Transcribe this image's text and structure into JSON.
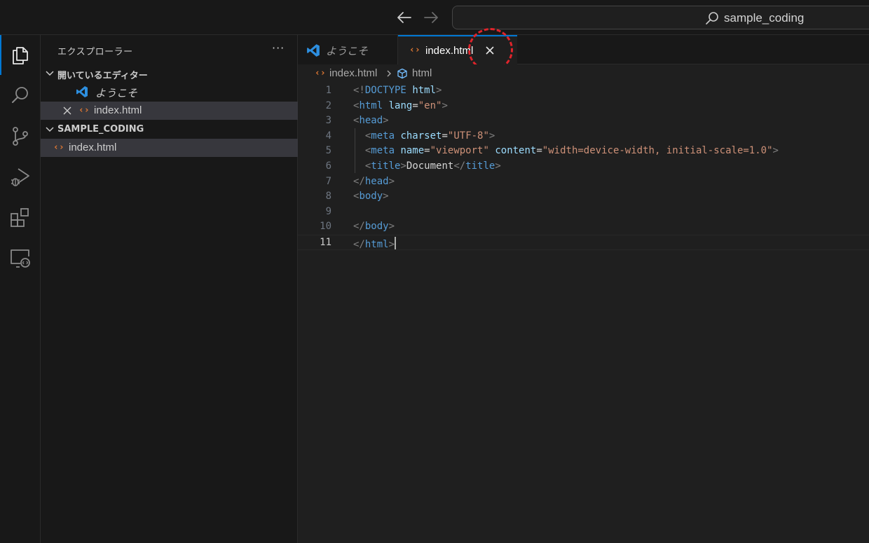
{
  "titlebar": {
    "search_text": "sample_coding"
  },
  "activity_bar": {
    "items": [
      "explorer-icon",
      "search-icon",
      "source-control-icon",
      "run-debug-icon",
      "extensions-icon",
      "remote-explorer-icon"
    ],
    "accent": "#0078d4"
  },
  "sidebar": {
    "title": "エクスプローラー",
    "more": "···",
    "open_editors": {
      "label": "開いているエディター",
      "items": [
        {
          "label": "ようこそ"
        },
        {
          "label": "index.html"
        }
      ]
    },
    "folder": {
      "label": "SAMPLE_CODING",
      "items": [
        {
          "label": "index.html"
        }
      ]
    }
  },
  "tabs": [
    {
      "label": "ようこそ"
    },
    {
      "label": "index.html"
    }
  ],
  "breadcrumb": {
    "file": "index.html",
    "symbol": "html"
  },
  "editor": {
    "line_numbers": [
      "1",
      "2",
      "3",
      "4",
      "5",
      "6",
      "7",
      "8",
      "9",
      "10",
      "11"
    ],
    "lines": [
      [
        [
          "punct",
          "<!"
        ],
        [
          "tag",
          "DOCTYPE"
        ],
        [
          "text",
          " "
        ],
        [
          "attr",
          "html"
        ],
        [
          "punct",
          ">"
        ]
      ],
      [
        [
          "punct",
          "<"
        ],
        [
          "tag",
          "html"
        ],
        [
          "text",
          " "
        ],
        [
          "attr",
          "lang"
        ],
        [
          "text",
          "="
        ],
        [
          "str",
          "\"en\""
        ],
        [
          "punct",
          ">"
        ]
      ],
      [
        [
          "punct",
          "<"
        ],
        [
          "tag",
          "head"
        ],
        [
          "punct",
          ">"
        ]
      ],
      [
        [
          "text",
          "  "
        ],
        [
          "punct",
          "<"
        ],
        [
          "tag",
          "meta"
        ],
        [
          "text",
          " "
        ],
        [
          "attr",
          "charset"
        ],
        [
          "text",
          "="
        ],
        [
          "str",
          "\"UTF-8\""
        ],
        [
          "punct",
          ">"
        ]
      ],
      [
        [
          "text",
          "  "
        ],
        [
          "punct",
          "<"
        ],
        [
          "tag",
          "meta"
        ],
        [
          "text",
          " "
        ],
        [
          "attr",
          "name"
        ],
        [
          "text",
          "="
        ],
        [
          "str",
          "\"viewport\""
        ],
        [
          "text",
          " "
        ],
        [
          "attr",
          "content"
        ],
        [
          "text",
          "="
        ],
        [
          "str",
          "\"width=device-width, initial-scale=1.0\""
        ],
        [
          "punct",
          ">"
        ]
      ],
      [
        [
          "text",
          "  "
        ],
        [
          "punct",
          "<"
        ],
        [
          "tag",
          "title"
        ],
        [
          "punct",
          ">"
        ],
        [
          "text",
          "Document"
        ],
        [
          "punct",
          "</"
        ],
        [
          "tag",
          "title"
        ],
        [
          "punct",
          ">"
        ]
      ],
      [
        [
          "punct",
          "</"
        ],
        [
          "tag",
          "head"
        ],
        [
          "punct",
          ">"
        ]
      ],
      [
        [
          "punct",
          "<"
        ],
        [
          "tag",
          "body"
        ],
        [
          "punct",
          ">"
        ]
      ],
      [],
      [
        [
          "punct",
          "</"
        ],
        [
          "tag",
          "body"
        ],
        [
          "punct",
          ">"
        ]
      ],
      [
        [
          "punct",
          "</"
        ],
        [
          "tag",
          "html"
        ],
        [
          "punct",
          ">"
        ]
      ]
    ],
    "current_line": 11
  },
  "annotation_color": "#e0242b"
}
